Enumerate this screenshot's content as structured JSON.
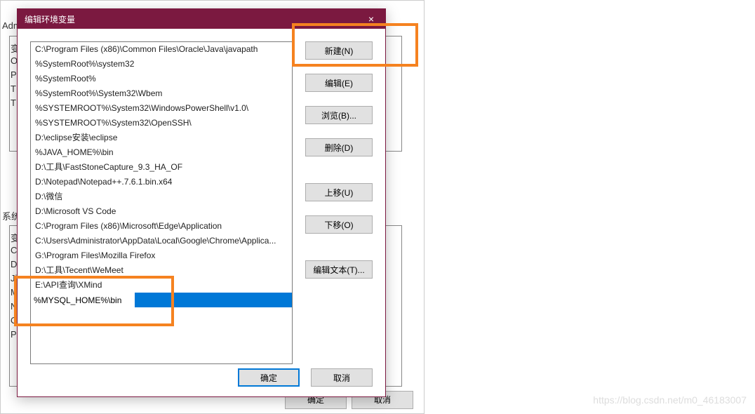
{
  "dialog": {
    "title": "编辑环境变量",
    "close_label": "×",
    "rows": [
      "C:\\Program Files (x86)\\Common Files\\Oracle\\Java\\javapath",
      "%SystemRoot%\\system32",
      "%SystemRoot%",
      "%SystemRoot%\\System32\\Wbem",
      "%SYSTEMROOT%\\System32\\WindowsPowerShell\\v1.0\\",
      "%SYSTEMROOT%\\System32\\OpenSSH\\",
      "D:\\eclipse安装\\eclipse",
      "%JAVA_HOME%\\bin",
      "D:\\工具\\FastStoneCapture_9.3_HA_OF",
      "D:\\Notepad\\Notepad++.7.6.1.bin.x64",
      "D:\\微信",
      "D:\\Microsoft VS Code",
      "C:\\Program Files (x86)\\Microsoft\\Edge\\Application",
      "C:\\Users\\Administrator\\AppData\\Local\\Google\\Chrome\\Applica...",
      "G:\\Program Files\\Mozilla Firefox",
      "D:\\工具\\Tecent\\WeMeet",
      "E:\\API查询\\XMind"
    ],
    "editing_value": "%MYSQL_HOME%\\bin",
    "buttons": {
      "new": "新建(N)",
      "edit": "编辑(E)",
      "browse": "浏览(B)...",
      "delete": "删除(D)",
      "moveup": "上移(U)",
      "movedown": "下移(O)",
      "edittext": "编辑文本(T)..."
    },
    "footer": {
      "ok": "确定",
      "cancel": "取消"
    }
  },
  "background": {
    "adm_label": "Adm",
    "sys_label": "系统",
    "col_labels": [
      "变",
      "O",
      "Pa",
      "TE",
      "TN"
    ],
    "col_labels2": [
      "变",
      "Co",
      "Di",
      "Ji",
      "M",
      "N",
      "O",
      "Pa"
    ],
    "ok": "确定",
    "cancel": "取消"
  },
  "watermark": "https://blog.csdn.net/m0_46183007"
}
